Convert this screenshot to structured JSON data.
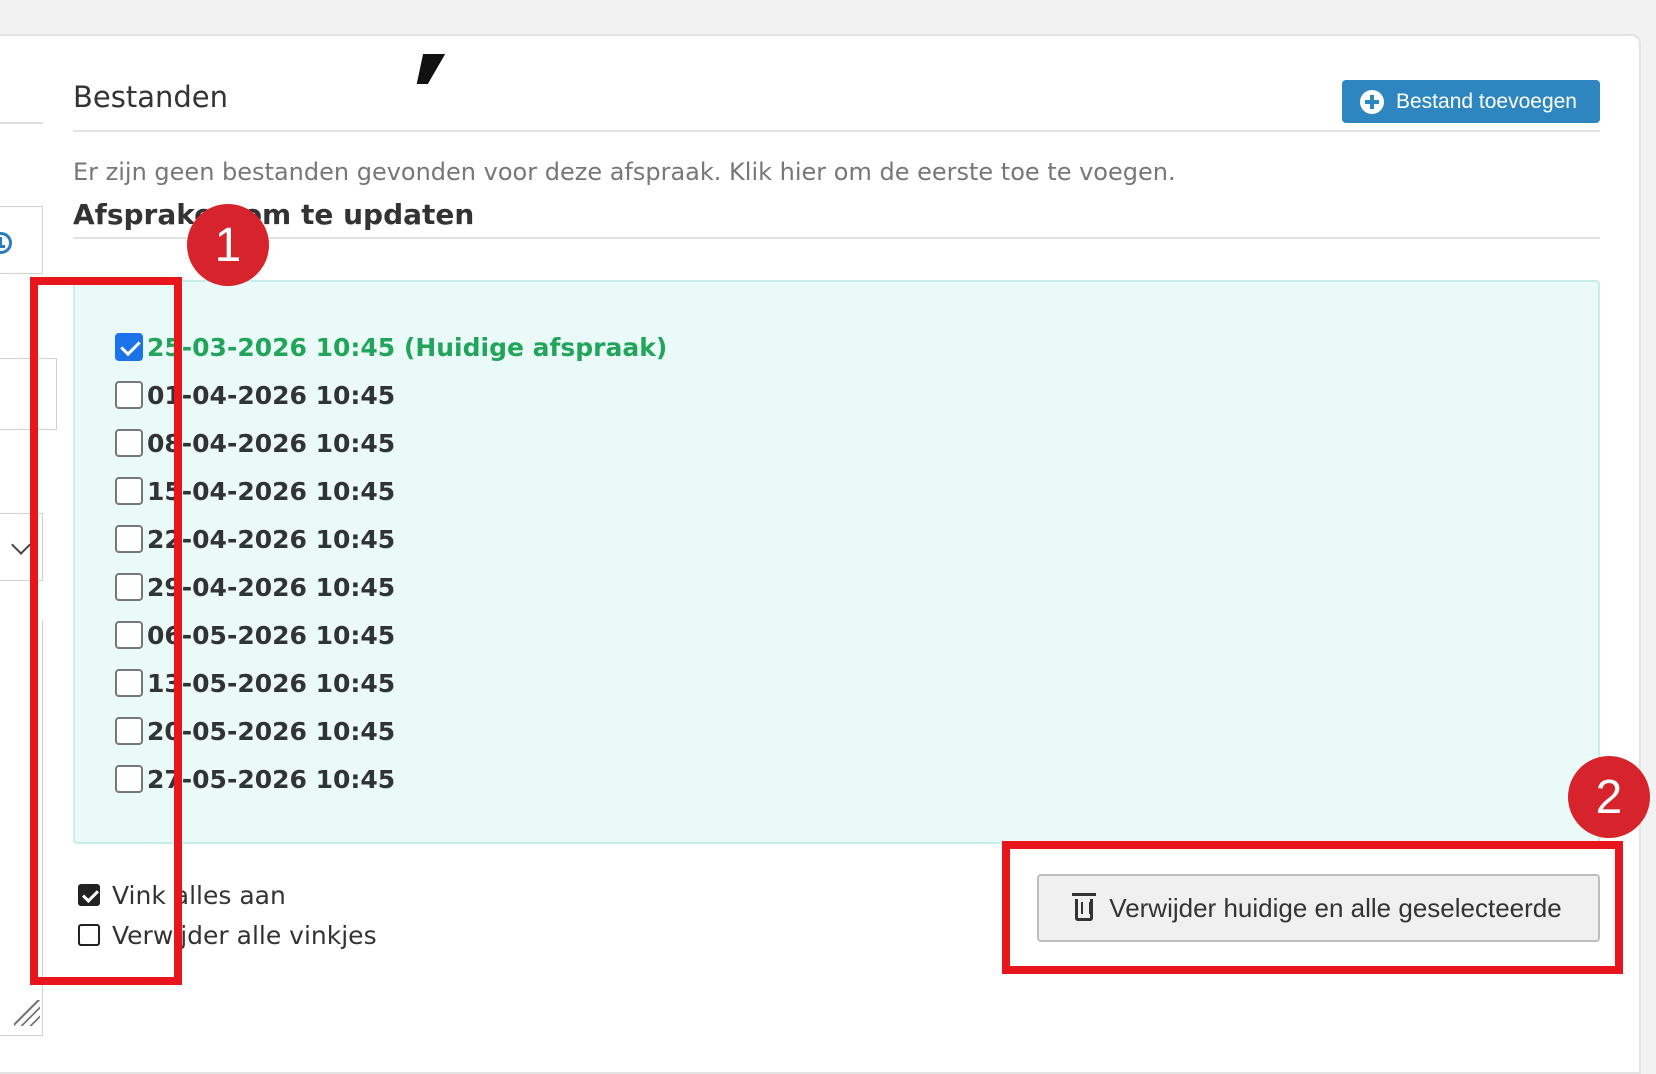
{
  "files_section": {
    "title": "Bestanden",
    "add_button_label": "Bestand toevoegen",
    "empty_message": "Er zijn geen bestanden gevonden voor deze afspraak. Klik hier om de eerste toe te voegen."
  },
  "appointments_section": {
    "title": "Afspraken om te updaten",
    "items": [
      {
        "label": "25-03-2026 10:45 (Huidige afspraak)",
        "checked": true,
        "current": true
      },
      {
        "label": "01-04-2026 10:45",
        "checked": false
      },
      {
        "label": "08-04-2026 10:45",
        "checked": false
      },
      {
        "label": "15-04-2026 10:45",
        "checked": false
      },
      {
        "label": "22-04-2026 10:45",
        "checked": false
      },
      {
        "label": "29-04-2026 10:45",
        "checked": false
      },
      {
        "label": "06-05-2026 10:45",
        "checked": false
      },
      {
        "label": "13-05-2026 10:45",
        "checked": false
      },
      {
        "label": "20-05-2026 10:45",
        "checked": false
      },
      {
        "label": "27-05-2026 10:45",
        "checked": false
      }
    ],
    "check_all_label": "Vink alles aan",
    "uncheck_all_label": "Verwijder alle vinkjes",
    "delete_button_label": "Verwijder huidige en alle geselecteerde"
  },
  "annotations": {
    "badge_1": "1",
    "badge_2": "2",
    "highlight_color": "#e8161c",
    "badge_color": "#d7232b"
  },
  "colors": {
    "primary_button": "#2e86c1",
    "current_appointment": "#22a55a",
    "appointment_box_bg": "#e9faf8"
  }
}
